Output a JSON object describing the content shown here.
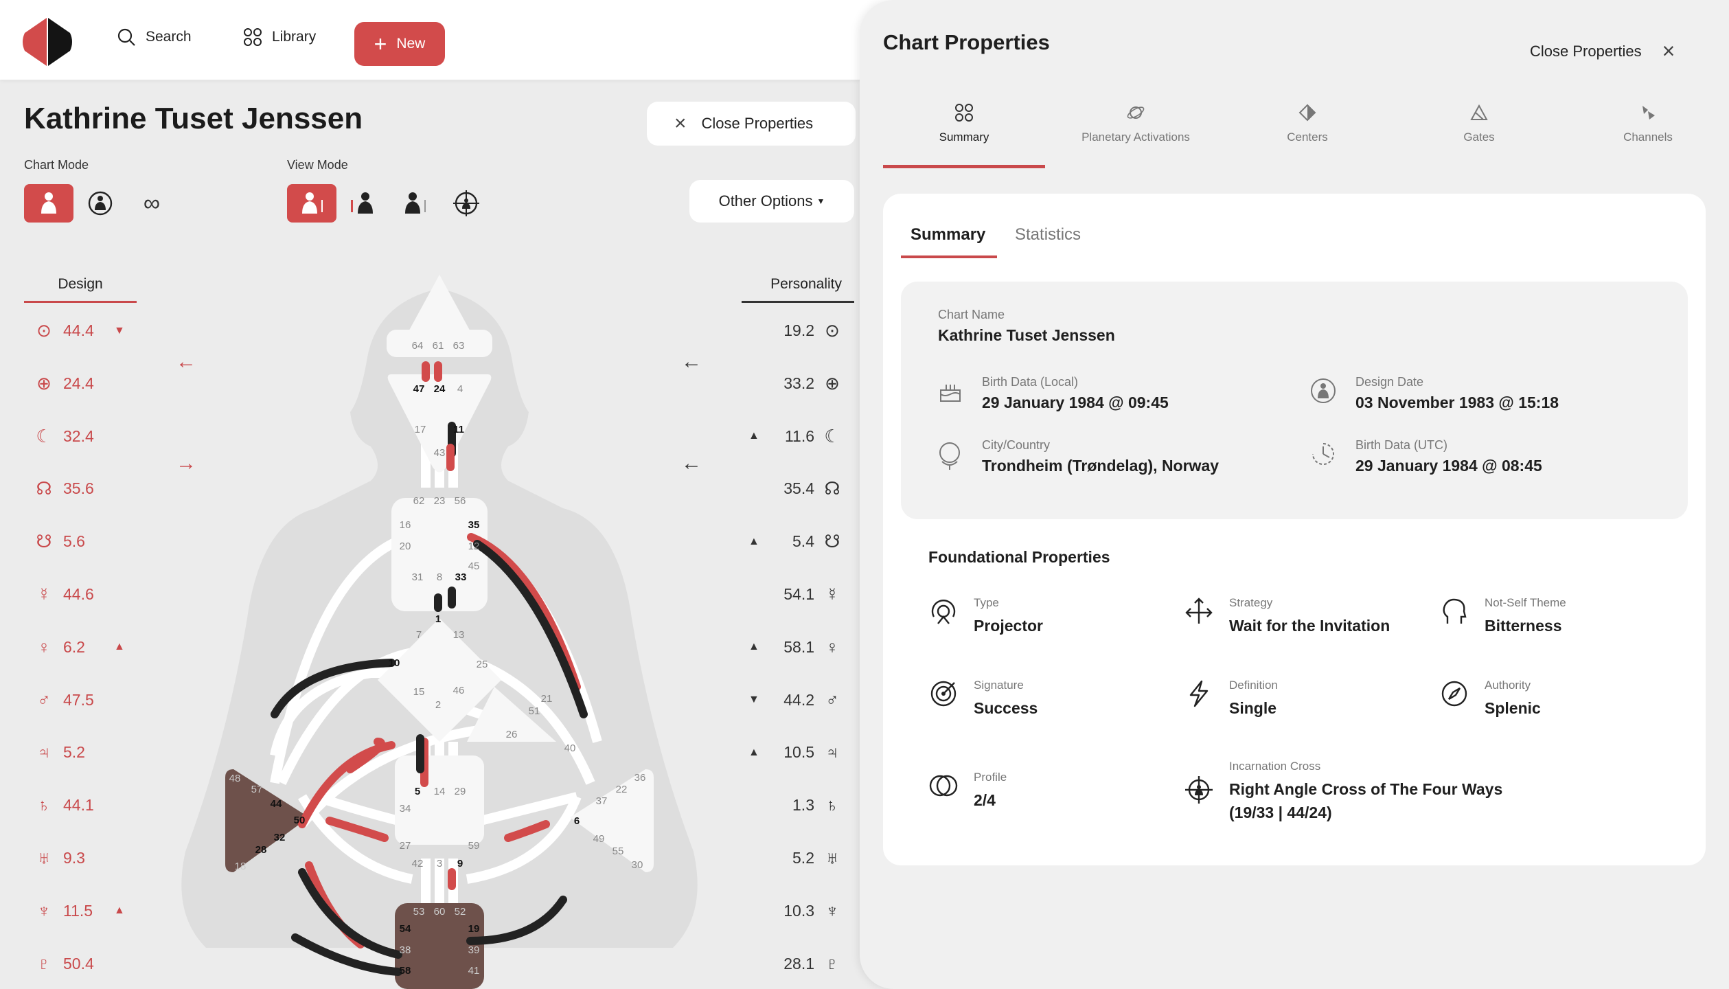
{
  "nav": {
    "search": "Search",
    "library": "Library",
    "new": "New"
  },
  "person": {
    "name": "Kathrine Tuset Jenssen"
  },
  "left_close": "Close Properties",
  "chart_mode_label": "Chart Mode",
  "view_mode_label": "View Mode",
  "other_options": "Other Options",
  "design_header": "Design",
  "personality_header": "Personality",
  "design": [
    {
      "icon": "⊙",
      "value": "44.4",
      "mark": "▼"
    },
    {
      "icon": "⊕",
      "value": "24.4",
      "mark": ""
    },
    {
      "icon": "☾",
      "value": "32.4",
      "mark": ""
    },
    {
      "icon": "☊",
      "value": "35.6",
      "mark": ""
    },
    {
      "icon": "☋",
      "value": "5.6",
      "mark": ""
    },
    {
      "icon": "☿",
      "value": "44.6",
      "mark": ""
    },
    {
      "icon": "♀",
      "value": "6.2",
      "mark": "▲"
    },
    {
      "icon": "♂",
      "value": "47.5",
      "mark": ""
    },
    {
      "icon": "♃",
      "value": "5.2",
      "mark": ""
    },
    {
      "icon": "♄",
      "value": "44.1",
      "mark": ""
    },
    {
      "icon": "♅",
      "value": "9.3",
      "mark": ""
    },
    {
      "icon": "♆",
      "value": "11.5",
      "mark": "▲"
    },
    {
      "icon": "♇",
      "value": "50.4",
      "mark": ""
    }
  ],
  "personality": [
    {
      "icon": "⊙",
      "value": "19.2",
      "mark": ""
    },
    {
      "icon": "⊕",
      "value": "33.2",
      "mark": ""
    },
    {
      "icon": "☾",
      "value": "11.6",
      "mark": "▲"
    },
    {
      "icon": "☊",
      "value": "35.4",
      "mark": ""
    },
    {
      "icon": "☋",
      "value": "5.4",
      "mark": "▲"
    },
    {
      "icon": "☿",
      "value": "54.1",
      "mark": ""
    },
    {
      "icon": "♀",
      "value": "58.1",
      "mark": "▲"
    },
    {
      "icon": "♂",
      "value": "44.2",
      "mark": "▼"
    },
    {
      "icon": "♃",
      "value": "10.5",
      "mark": "▲"
    },
    {
      "icon": "♄",
      "value": "1.3",
      "mark": ""
    },
    {
      "icon": "♅",
      "value": "5.2",
      "mark": ""
    },
    {
      "icon": "♆",
      "value": "10.3",
      "mark": ""
    },
    {
      "icon": "♇",
      "value": "28.1",
      "mark": ""
    }
  ],
  "gates": {
    "g64": "64",
    "g61": "61",
    "g63": "63",
    "g47": "47",
    "g24": "24",
    "g4": "4",
    "g17": "17",
    "g11": "11",
    "g43": "43",
    "g62": "62",
    "g23": "23",
    "g56": "56",
    "g16": "16",
    "g35": "35",
    "g20": "20",
    "g12": "12",
    "g45": "45",
    "g31": "31",
    "g8": "8",
    "g33": "33",
    "g1": "1",
    "g7": "7",
    "g13": "13",
    "g10": "10",
    "g25": "25",
    "g15": "15",
    "g46": "46",
    "g2": "2",
    "g21": "21",
    "g51": "51",
    "g26": "26",
    "g40": "40",
    "g48": "48",
    "g57": "57",
    "g44": "44",
    "g50": "50",
    "g32": "32",
    "g28": "28",
    "g18": "18",
    "g5": "5",
    "g14": "14",
    "g29": "29",
    "g34": "34",
    "g27": "27",
    "g59": "59",
    "g42": "42",
    "g3": "3",
    "g9": "9",
    "g36": "36",
    "g22": "22",
    "g37": "37",
    "g6": "6",
    "g49": "49",
    "g55": "55",
    "g30": "30",
    "g53": "53",
    "g60": "60",
    "g52": "52",
    "g54": "54",
    "g19": "19",
    "g38": "38",
    "g39": "39",
    "g58": "58",
    "g41": "41"
  },
  "panel": {
    "title": "Chart Properties",
    "close": "Close Properties",
    "tabs": [
      "Summary",
      "Planetary Activations",
      "Centers",
      "Gates",
      "Channels"
    ],
    "subtabs": [
      "Summary",
      "Statistics"
    ],
    "chart_name_label": "Chart Name",
    "chart_name": "Kathrine Tuset Jenssen",
    "birth_local_label": "Birth Data (Local)",
    "birth_local": "29 January 1984 @ 09:45",
    "design_date_label": "Design Date",
    "design_date": "03 November 1983 @ 15:18",
    "city_label": "City/Country",
    "city": "Trondheim (Trøndelag), Norway",
    "birth_utc_label": "Birth Data (UTC)",
    "birth_utc": "29 January 1984 @ 08:45",
    "foundational_title": "Foundational Properties",
    "type_label": "Type",
    "type": "Projector",
    "strategy_label": "Strategy",
    "strategy": "Wait for the Invitation",
    "notself_label": "Not-Self Theme",
    "notself": "Bitterness",
    "signature_label": "Signature",
    "signature": "Success",
    "definition_label": "Definition",
    "definition": "Single",
    "authority_label": "Authority",
    "authority": "Splenic",
    "profile_label": "Profile",
    "profile": "2/4",
    "cross_label": "Incarnation Cross",
    "cross_line1": "Right Angle Cross of The Four Ways",
    "cross_line2": "(19/33 | 44/24)"
  },
  "colors": {
    "accent": "#d24b4b",
    "dark": "#222222",
    "brown": "#6e514b"
  }
}
